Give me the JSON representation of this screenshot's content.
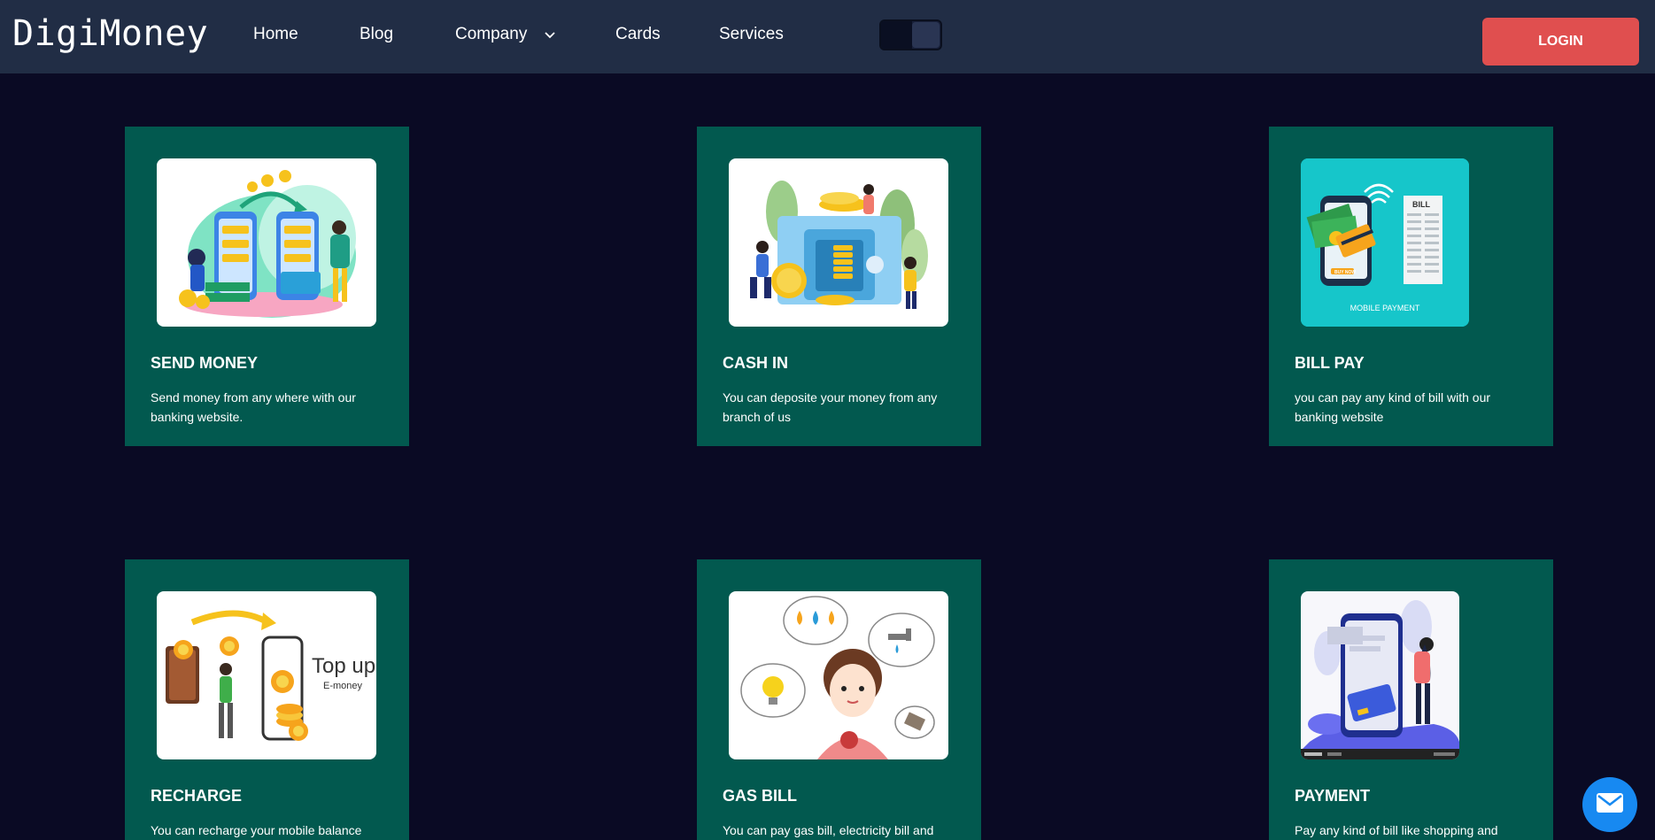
{
  "brand": "DigiMoney",
  "nav": {
    "home": "Home",
    "blog": "Blog",
    "company": "Company",
    "cards": "Cards",
    "services": "Services"
  },
  "login_label": "LOGIN",
  "cards": [
    {
      "title": "SEND MONEY",
      "desc": "Send money from any where with our banking website."
    },
    {
      "title": "CASH IN",
      "desc": "You can deposite your money from any branch of us"
    },
    {
      "title": "BILL PAY",
      "desc": "you can pay any kind of bill with our banking website"
    },
    {
      "title": "RECHARGE",
      "desc": "You can recharge your mobile balance with help of our banking website"
    },
    {
      "title": "GAS BILL",
      "desc": "You can pay gas bill, electricity bill and water bill with the help of our banking website"
    },
    {
      "title": "PAYMENT",
      "desc": "Pay any kind of bill like shopping and food bill with the bill of our banking website"
    }
  ],
  "illustrations": {
    "bill_label": "BILL",
    "mobile_payment": "MOBILE PAYMENT",
    "top_up": "Top up",
    "e_money": "E-money"
  },
  "colors": {
    "background": "#0a0a24",
    "navbar": "#212d45",
    "card": "#02594f",
    "login": "#e04f4f",
    "mail_button": "#1789f1"
  }
}
